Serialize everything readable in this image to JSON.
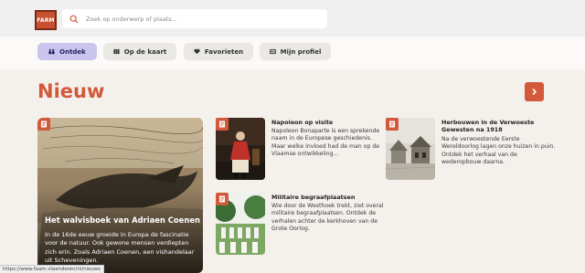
{
  "header": {
    "logo_text": "FARM",
    "search_placeholder": "Zoek op onderwerp of plaats..."
  },
  "nav": [
    {
      "label": "Ontdek",
      "icon": "binoculars-icon",
      "active": true
    },
    {
      "label": "Op de kaart",
      "icon": "map-icon",
      "active": false
    },
    {
      "label": "Favorieten",
      "icon": "heart-icon",
      "active": false
    },
    {
      "label": "Mijn profiel",
      "icon": "id-card-icon",
      "active": false
    }
  ],
  "section": {
    "title": "Nieuw",
    "next_icon": "chevron-right-icon"
  },
  "featured": {
    "title": "Het walvisboek van Adriaen Coenen",
    "text": "In de 16de eeuw groeide in Europa de fascinatie voor de natuur. Ook gewone mensen verdiepten zich erin. Zoals Adriaen Coenen, een vishandelaar uit Scheveningen."
  },
  "cards": [
    {
      "title": "Napoleon op visite",
      "text": "Napoleon Bonaparte is een sprekende naam in de Europese geschiedenis. Maar welke invloed had de man op de Vlaamse ontwikkeling..."
    },
    {
      "title": "Herbouwen in de Verwoeste Gewesten na 1918",
      "text": "Na de verwoestende Eerste Wereldoorlog lagen onze huizen in puin. Ontdek het verhaal van de wederopbouw daarna."
    },
    {
      "title": "Militaire begraafplaatsen",
      "text": "Wie door de Westhoek trekt, ziet overal militaire begraafplaatsen. Ontdek de verhalen achter de kerkhoven van de Grote Oorlog."
    }
  ],
  "status_url": "https://www.faam.vlaanderen/nl/nieuws",
  "colors": {
    "accent": "#d2593a",
    "active_tab": "#c9c5ee",
    "background": "#f4f1ec"
  }
}
